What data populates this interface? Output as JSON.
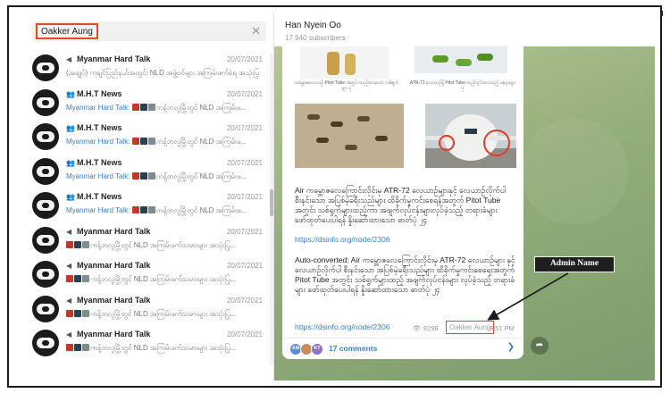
{
  "search": {
    "query": "Oakker Aung",
    "clear_icon": "close-icon"
  },
  "chats": [
    {
      "type_icon": "megaphone-icon",
      "type_glyph": "◀",
      "title": "Myanmar Hard Talk",
      "date": "20/07/2021",
      "sender": "",
      "emojis": [],
      "preview": "(အချုပ်) ကချင်ပြည်နယ်အတွင်း NLD အဖွဲ့ဝင်များ အကြမ်းဖက်ခံရ အသုံးပြု"
    },
    {
      "type_icon": "group-icon",
      "type_glyph": "👥",
      "title": "M.H.T News",
      "date": "20/07/2021",
      "sender": "Myanmar Hard Talk:",
      "emojis": [
        "#c0392b",
        "#2c3e50",
        "#7f8c8d"
      ],
      "preview": "ကန့်ဘလူမြို့တွင် NLD အကြမ်းဖ..."
    },
    {
      "type_icon": "group-icon",
      "type_glyph": "👥",
      "title": "M.H.T News",
      "date": "20/07/2021",
      "sender": "Myanmar Hard Talk:",
      "emojis": [
        "#c0392b",
        "#2c3e50",
        "#7f8c8d"
      ],
      "preview": "ကန့်ဘလူမြို့တွင် NLD အကြမ်းဖ..."
    },
    {
      "type_icon": "group-icon",
      "type_glyph": "👥",
      "title": "M.H.T News",
      "date": "20/07/2021",
      "sender": "Myanmar Hard Talk:",
      "emojis": [
        "#c0392b",
        "#2c3e50",
        "#7f8c8d"
      ],
      "preview": "ကန့်ဘလူမြို့တွင် NLD အကြမ်းဖ..."
    },
    {
      "type_icon": "group-icon",
      "type_glyph": "👥",
      "title": "M.H.T News",
      "date": "20/07/2021",
      "sender": "Myanmar Hard Talk:",
      "emojis": [
        "#c0392b",
        "#2c3e50",
        "#7f8c8d"
      ],
      "preview": "ကန့်ဘလူမြို့တွင် NLD အကြမ်းဖ..."
    },
    {
      "type_icon": "megaphone-icon",
      "type_glyph": "◀",
      "title": "Myanmar Hard Talk",
      "date": "20/07/2021",
      "sender": "",
      "emojis": [
        "#c0392b",
        "#2c3e50",
        "#7f8c8d"
      ],
      "preview": "ကန့်ဘလူမြို့တွင် NLD အကြမ်းဖက်သမားများ အသုံးပြု..."
    },
    {
      "type_icon": "megaphone-icon",
      "type_glyph": "◀",
      "title": "Myanmar Hard Talk",
      "date": "20/07/2021",
      "sender": "",
      "emojis": [
        "#c0392b",
        "#2c3e50",
        "#7f8c8d"
      ],
      "preview": "ကန့်ဘလူမြို့တွင် NLD အကြမ်းဖက်သမားများ အသုံးပြု..."
    },
    {
      "type_icon": "megaphone-icon",
      "type_glyph": "◀",
      "title": "Myanmar Hard Talk",
      "date": "20/07/2021",
      "sender": "",
      "emojis": [
        "#c0392b",
        "#2c3e50",
        "#7f8c8d"
      ],
      "preview": "ကန့်ဘလူမြို့တွင် NLD အကြမ်းဖက်သမားများ အသုံးပြု..."
    },
    {
      "type_icon": "megaphone-icon",
      "type_glyph": "◀",
      "title": "Myanmar Hard Talk",
      "date": "20/07/2021",
      "sender": "",
      "emojis": [
        "#c0392b",
        "#2c3e50",
        "#7f8c8d"
      ],
      "preview": "ကန့်ဘလူမြို့တွင် NLD အကြမ်းဖက်သမားများ အသုံးပြု..."
    }
  ],
  "channel": {
    "name": "Han Nyein Oo",
    "subscribers": "17,940 subscribers"
  },
  "post": {
    "text_1": "Air ကမ္ဘောဇလေကြောင်းလိုင်းမှ ATR-72 လေယာဉ်များနှင့် လေယာဉ်လိုက်ပါ စီးနင်းသော အပြစ်မဲ့ခရီးသည်များ ထိခိုက်မှုကင်းစေရန်အတွက် Pitot Tube အတွင်း သစ်ရွက်များထည့်ကာ အဖျက်လုပ်ငန်းများလုပ်ခဲ့သည့် တရားခံများ ဖော်ထုတ်ပေးပါရန် နှိုးဆော်ထားသော ဓာတ်ပုံ ၂၄",
    "link_1": "https://dsinfo.org/node/2306",
    "text_2": "Auto-converted: Air ကမ္ဘောဇလေကြောင်းလိုင်းမှ ATR-72 လေယာဉ်များ နှင့် လေယာဉ်လိုက်ပါ စီးနင်းသော အပြစ်မဲ့ခရီးသည်များ ထိခိုက်မှုကင်းစေရေးအတွက် Pitot Tube အတွင်း သစ်ရွက်များထည့် အဖျက်လုပ်ငန်းများ လုပ်ခဲ့သည့် တရားခံများ ဖော်ထုတ်ပေးပါရန် နှိုးဆော်ထားသော ဓာတ်ပုံ ၂၄",
    "link_2": "https://dsinfo.org/node/2306",
    "views": "8298",
    "author": "Oakker Aung",
    "time": "9:51 PM",
    "caption_1": "ကမ္ဘောဇလေယာဉ် Pitot Tube အတွင်း ထည့်ထားသော သစ်ရွက်များ ပုံ",
    "caption_2": "ATR-72 လေယာဉ်ရှိ Pitot Tube ထည့်သွင်းထားသည့် နေရာများ ပုံ"
  },
  "comments": {
    "label": "17 comments",
    "avatars": [
      "AM",
      "",
      "KT"
    ]
  },
  "annotation": {
    "label": "Admin Name"
  },
  "colors": {
    "accent": "#3a82c8",
    "highlight": "#e04a2a",
    "chat_bg": "#93ae7a"
  }
}
